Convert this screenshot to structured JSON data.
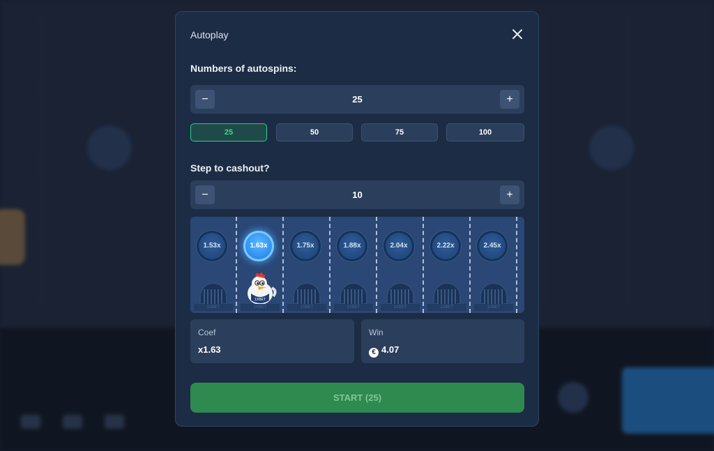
{
  "modal": {
    "title": "Autoplay",
    "close_icon": "close-icon"
  },
  "autospins": {
    "label": "Numbers of autospins:",
    "minus": "−",
    "value": "25",
    "plus": "+",
    "presets": [
      "25",
      "50",
      "75",
      "100"
    ],
    "selected_preset": "25"
  },
  "cashout": {
    "label": "Step to cashout?",
    "minus": "−",
    "value": "10",
    "plus": "+"
  },
  "track": {
    "coefficients": [
      "1.53x",
      "1.63x",
      "1.75x",
      "1.88x",
      "2.04x",
      "2.22x",
      "2.45x"
    ],
    "active_index": 1,
    "base_text": "1XBET",
    "chicken_icon": "chicken-icon"
  },
  "coef": {
    "label": "Coef",
    "value": "x1.63"
  },
  "win": {
    "label": "Win",
    "currency_symbol": "€",
    "value": "4.07"
  },
  "start_button": {
    "label": "START (25)"
  },
  "colors": {
    "modal_bg": "#1c2c44",
    "accent_green": "#2bd187",
    "start_green": "#2e8a4f",
    "coin_active": "#2f8ff0"
  }
}
